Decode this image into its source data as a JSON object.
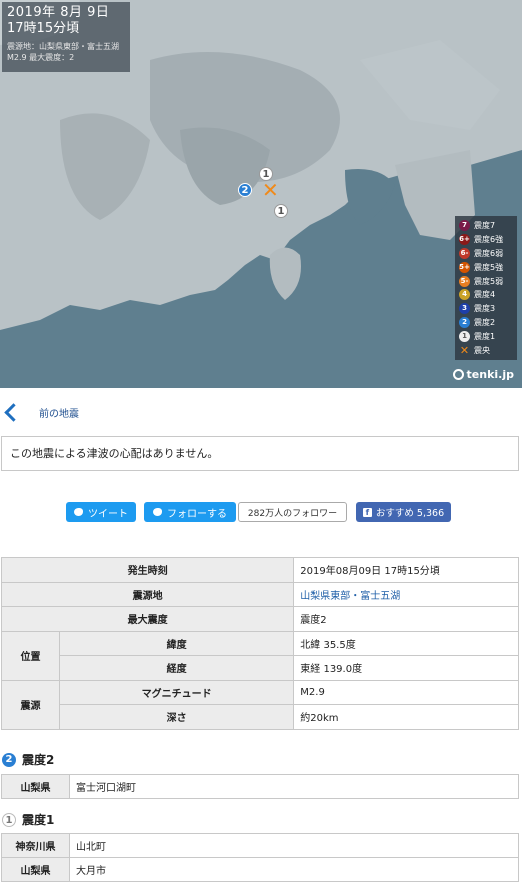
{
  "map": {
    "date": "2019年  8月  9日",
    "time": "17時15分頃",
    "source": "震源地：山梨県東部・富士五湖",
    "magnitude_line": "M2.9    最大震度：2",
    "markers": [
      {
        "label": "1"
      },
      {
        "label": "2"
      },
      {
        "label": "1"
      }
    ],
    "epicenter_symbol": "✕",
    "legend": [
      {
        "glyph": "7",
        "label": "震度7",
        "color": "#7a1a48"
      },
      {
        "glyph": "6+",
        "label": "震度6強",
        "color": "#8b1a1a"
      },
      {
        "glyph": "6-",
        "label": "震度6弱",
        "color": "#c0392b"
      },
      {
        "glyph": "5+",
        "label": "震度5強",
        "color": "#d35400"
      },
      {
        "glyph": "5-",
        "label": "震度5弱",
        "color": "#e67e22"
      },
      {
        "glyph": "4",
        "label": "震度4",
        "color": "#c9a227"
      },
      {
        "glyph": "3",
        "label": "震度3",
        "color": "#1e3fa8"
      },
      {
        "glyph": "2",
        "label": "震度2",
        "color": "#2a7fd3"
      },
      {
        "glyph": "1",
        "label": "震度1",
        "color": "#eeeeee"
      },
      {
        "glyph": "✕",
        "label": "震央",
        "color": "#f08a1a"
      }
    ],
    "logo": "tenki.jp"
  },
  "nav": {
    "prev_label": "前の地震"
  },
  "tsunami": "この地震による津波の心配はありません。",
  "social": {
    "tweet": "ツイート",
    "follow": "フォローする",
    "followers": "282万人のフォロワー",
    "recommend": "おすすめ 5,366"
  },
  "detail": {
    "occurred_label": "発生時刻",
    "occurred": "2019年08月09日 17時15分頃",
    "epicenter_label": "震源地",
    "epicenter": "山梨県東部・富士五湖",
    "max_int_label": "最大震度",
    "max_int": "震度2",
    "position_label": "位置",
    "lat_label": "緯度",
    "lat": "北緯 35.5度",
    "lon_label": "経度",
    "lon": "東経 139.0度",
    "hypo_label": "震源",
    "mag_label": "マグニチュード",
    "mag": "M2.9",
    "depth_label": "深さ",
    "depth": "約20km"
  },
  "intensity2": {
    "badge": "2",
    "title": "震度2",
    "rows": [
      {
        "pref": "山梨県",
        "towns": "富士河口湖町"
      }
    ]
  },
  "intensity1": {
    "badge": "1",
    "title": "震度1",
    "rows": [
      {
        "pref": "神奈川県",
        "towns": "山北町"
      },
      {
        "pref": "山梨県",
        "towns": "大月市"
      }
    ]
  }
}
